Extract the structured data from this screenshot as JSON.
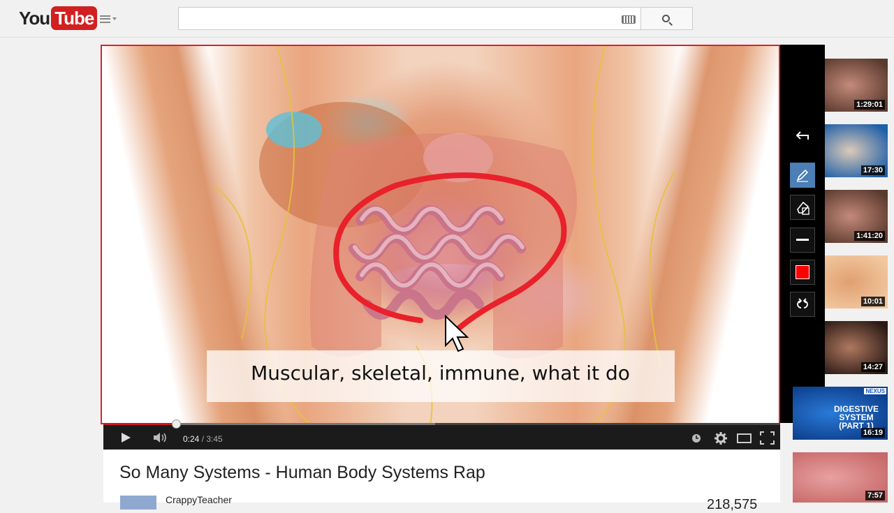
{
  "header": {
    "logo_you": "You",
    "logo_tube": "Tube",
    "search_value": "",
    "search_placeholder": ""
  },
  "player": {
    "caption": "Muscular, skeletal, immune, what it do",
    "current_time": "0:24",
    "duration": "3:45",
    "progress_fraction": 0.107,
    "buffer_fraction": 0.49,
    "annotation_color": "#e8212b"
  },
  "draw_tools": {
    "tools": [
      {
        "name": "undo-icon"
      },
      {
        "name": "pen-icon",
        "active": true
      },
      {
        "name": "eraser-icon"
      },
      {
        "name": "line-width-icon"
      },
      {
        "name": "color-swatch",
        "color": "#ff0000"
      },
      {
        "name": "redo-undo-icon"
      }
    ]
  },
  "video": {
    "title": "So Many Systems - Human Body Systems Rap",
    "channel": "CrappyTeacher",
    "views": "218,575"
  },
  "sidebar": {
    "thumbnails": [
      {
        "duration": "1:29:01",
        "text": "",
        "color1": "#5a3a2e",
        "color2": "#c48a7a"
      },
      {
        "duration": "17:30",
        "text": "",
        "color1": "#1f5fa8",
        "color2": "#dccab8"
      },
      {
        "duration": "1:41:20",
        "text": "",
        "color1": "#5a3a2e",
        "color2": "#c48a7a"
      },
      {
        "duration": "10:01",
        "text": "",
        "color1": "#f2c8a0",
        "color2": "#e0a070"
      },
      {
        "duration": "14:27",
        "text": "",
        "color1": "#2a1a14",
        "color2": "#b07860"
      },
      {
        "duration": "16:19",
        "text": "DIGESTIVE SYSTEM (PART 1)",
        "badge": "NEXUS",
        "color1": "#0c3d8a",
        "color2": "#2a7ad8"
      },
      {
        "duration": "7:57",
        "text": "",
        "color1": "#c86a6a",
        "color2": "#e8a0a0"
      }
    ]
  }
}
